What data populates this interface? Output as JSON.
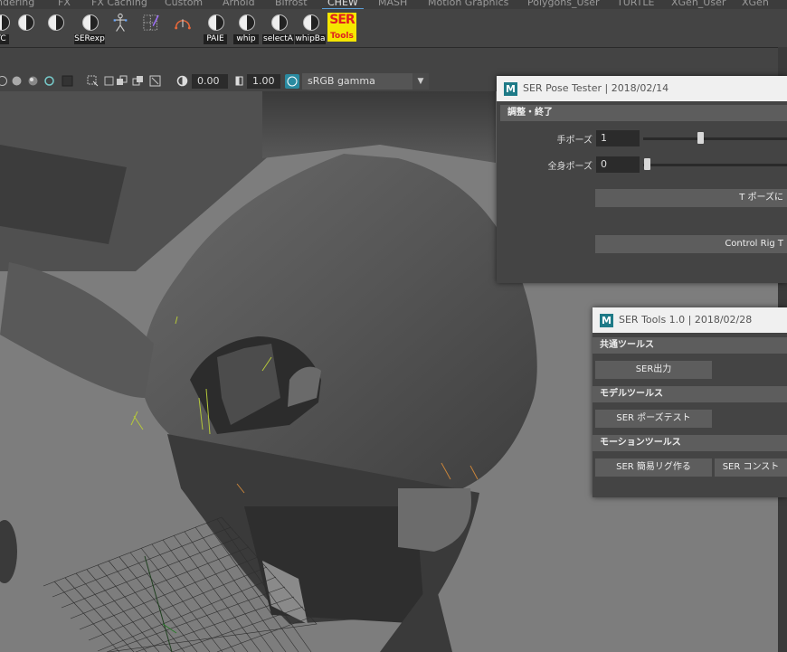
{
  "shelf_tabs": [
    {
      "label": "ndering",
      "active": false
    },
    {
      "label": "FX",
      "active": false
    },
    {
      "label": "FX Caching",
      "active": false
    },
    {
      "label": "Custom",
      "active": false
    },
    {
      "label": "Arnold",
      "active": false
    },
    {
      "label": "Bifrost",
      "active": false
    },
    {
      "label": "CHEW",
      "active": true
    },
    {
      "label": "MASH",
      "active": false
    },
    {
      "label": "Motion Graphics",
      "active": false
    },
    {
      "label": "Polygons_User",
      "active": false
    },
    {
      "label": "TURTLE",
      "active": false
    },
    {
      "label": "XGen_User",
      "active": false
    },
    {
      "label": "XGen",
      "active": false
    }
  ],
  "shelf": {
    "buttons": [
      {
        "label": "TC",
        "icon": "python-icon"
      },
      {
        "label": "",
        "icon": "python-icon"
      },
      {
        "label": "",
        "icon": "python-icon"
      },
      {
        "label": "SERexp",
        "icon": "python-icon"
      },
      {
        "label": "",
        "icon": "rig-figure-icon"
      },
      {
        "label": "",
        "icon": "selection-grid-icon"
      },
      {
        "label": "",
        "icon": "headphone-arc-icon"
      },
      {
        "label": "PAIE",
        "icon": "python-icon"
      },
      {
        "label": "whip",
        "icon": "python-icon"
      },
      {
        "label": "selectA",
        "icon": "python-icon"
      },
      {
        "label": "whipBa",
        "icon": "python-icon"
      }
    ],
    "ser_tools_logo": {
      "top": "SER",
      "bottom": "Tools"
    }
  },
  "panel_toolbar": {
    "exposure_value": "0.00",
    "gamma_value": "1.00",
    "color_space": "sRGB gamma"
  },
  "pose_tester": {
    "title": "SER Pose Tester | 2018/02/14",
    "section": "調整・終了",
    "hand_pose": {
      "label": "手ポーズ",
      "value": "1",
      "slider_fraction": 0.43
    },
    "body_pose": {
      "label": "全身ポーズ",
      "value": "0",
      "slider_fraction": 0.0
    },
    "t_pose_button": "T ポーズに",
    "control_rig_button": "Control Rig T"
  },
  "ser_tools": {
    "title": "SER Tools 1.0 | 2018/02/28",
    "sections": [
      {
        "header": "共通ツールス",
        "buttons": [
          "SER出力"
        ]
      },
      {
        "header": "モデルツールス",
        "buttons": [
          "SER ポーズテスト"
        ]
      },
      {
        "header": "モーションツールス",
        "buttons": [
          "SER 簡易リグ作る",
          "SER コンスト"
        ]
      }
    ]
  },
  "colors": {
    "maya_icon": "#1e7a87",
    "ser_logo_bg": "#f5e600",
    "ser_logo_text": "#e02020",
    "active_tab_underline": "#5aa0d8"
  }
}
